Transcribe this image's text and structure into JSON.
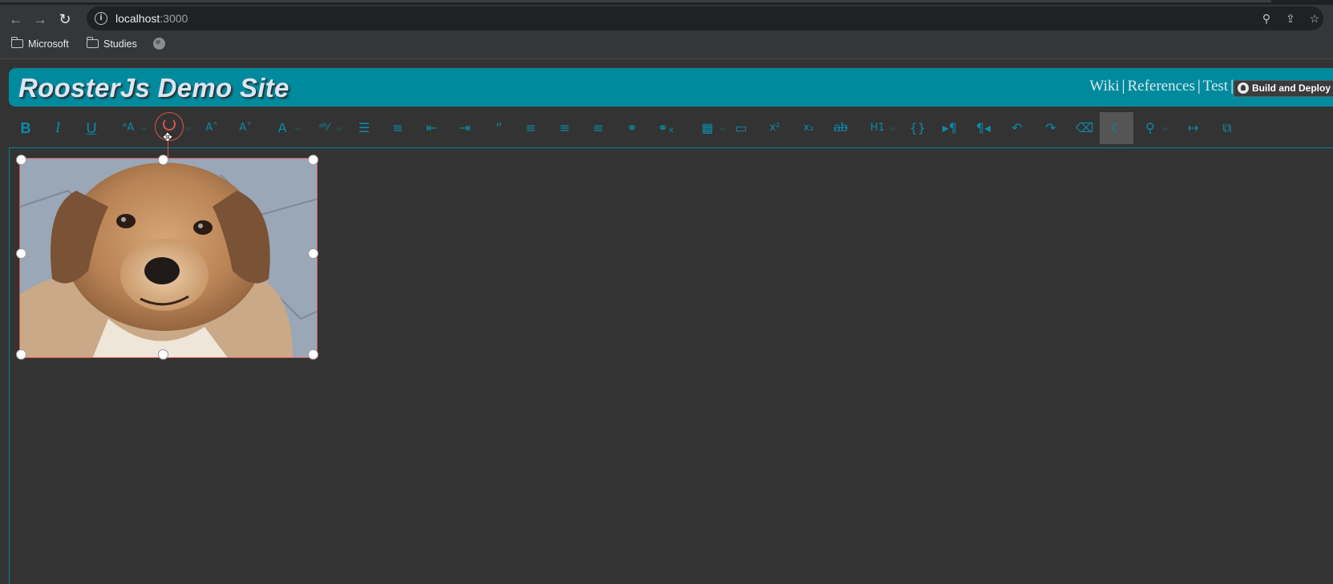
{
  "browser": {
    "url_host": "localhost",
    "url_port": ":3000",
    "bookmarks": [
      {
        "label": "Microsoft",
        "icon": "folder-icon"
      },
      {
        "label": "Studies",
        "icon": "folder-icon"
      },
      {
        "label": "",
        "icon": "globe-icon"
      }
    ]
  },
  "header": {
    "title": "RoosterJs Demo Site",
    "links": [
      "Wiki",
      "References",
      "Test"
    ],
    "build_button": "Build and Deploy",
    "title_bar_color": "#008a9e"
  },
  "toolbar": {
    "accent_color": "#0c8aa8",
    "buttons": [
      {
        "name": "bold-button",
        "glyph": "B"
      },
      {
        "name": "italic-button",
        "glyph": "I"
      },
      {
        "name": "underline-button",
        "glyph": "U"
      },
      {
        "name": "font-button",
        "glyph": "ᴬA",
        "dropdown": true
      },
      {
        "name": "font-size-button",
        "glyph": "",
        "dropdown": true
      },
      {
        "name": "increase-font-size-button",
        "glyph": "A˄"
      },
      {
        "name": "decrease-font-size-button",
        "glyph": "A˅"
      },
      {
        "name": "text-color-button",
        "glyph": "A",
        "dropdown": true
      },
      {
        "name": "background-color-button",
        "glyph": "ᵃᵇ⁄",
        "dropdown": true
      },
      {
        "name": "bullet-list-button",
        "glyph": "☰"
      },
      {
        "name": "numbered-list-button",
        "glyph": "≡"
      },
      {
        "name": "decrease-indent-button",
        "glyph": "⇤"
      },
      {
        "name": "increase-indent-button",
        "glyph": "⇥"
      },
      {
        "name": "quote-button",
        "glyph": "”"
      },
      {
        "name": "align-left-button",
        "glyph": "≡"
      },
      {
        "name": "align-center-button",
        "glyph": "≡"
      },
      {
        "name": "align-right-button",
        "glyph": "≡"
      },
      {
        "name": "insert-link-button",
        "glyph": "⚭"
      },
      {
        "name": "remove-link-button",
        "glyph": "⚭ₓ"
      },
      {
        "name": "insert-table-button",
        "glyph": "▦",
        "dropdown": true
      },
      {
        "name": "insert-image-button",
        "glyph": "▭"
      },
      {
        "name": "superscript-button",
        "glyph": "x²"
      },
      {
        "name": "subscript-button",
        "glyph": "x₂"
      },
      {
        "name": "strikethrough-button",
        "glyph": "ab"
      },
      {
        "name": "heading-button",
        "glyph": "H1",
        "dropdown": true
      },
      {
        "name": "code-button",
        "glyph": "{}"
      },
      {
        "name": "ltr-button",
        "glyph": "▸¶"
      },
      {
        "name": "rtl-button",
        "glyph": "¶◂"
      },
      {
        "name": "undo-button",
        "glyph": "↶"
      },
      {
        "name": "redo-button",
        "glyph": "↷"
      },
      {
        "name": "clear-format-button",
        "glyph": "⌫"
      },
      {
        "name": "dark-mode-button",
        "glyph": "☾",
        "highlight": true
      },
      {
        "name": "zoom-button",
        "glyph": "⚲",
        "dropdown": true
      },
      {
        "name": "format-painter-button",
        "glyph": "↦"
      },
      {
        "name": "popout-button",
        "glyph": "⧉"
      }
    ]
  },
  "editor": {
    "image_alt": "Dog photo",
    "selection_color": "#d9534f"
  }
}
